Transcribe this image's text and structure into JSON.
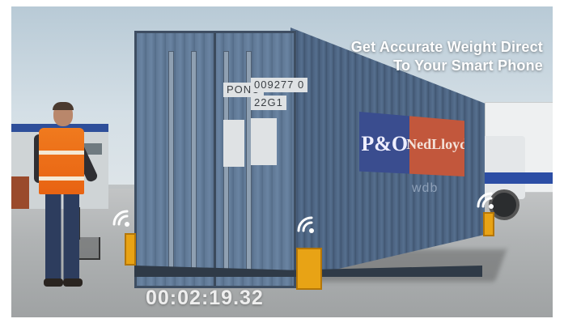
{
  "overlay": {
    "headline_line1": "Get Accurate Weight Direct",
    "headline_line2": "To Your Smart Phone",
    "timer": "00:02:19.32"
  },
  "container": {
    "plate_code": "PONU",
    "plate_number": "009277 0",
    "plate_type": "22G1",
    "logo_left": "P&O",
    "logo_right": "NedLloyd",
    "logo_sub": "wdb"
  },
  "colors": {
    "container_blue": "#5f7895",
    "safety_vest": "#f07a1e",
    "scale_yellow": "#e8a315",
    "logo_blue": "#3a4d8f",
    "logo_orange": "#c2573c"
  },
  "icons": [
    "wifi-signal-icon",
    "wifi-signal-icon",
    "wifi-signal-icon",
    "wifi-signal-icon"
  ]
}
